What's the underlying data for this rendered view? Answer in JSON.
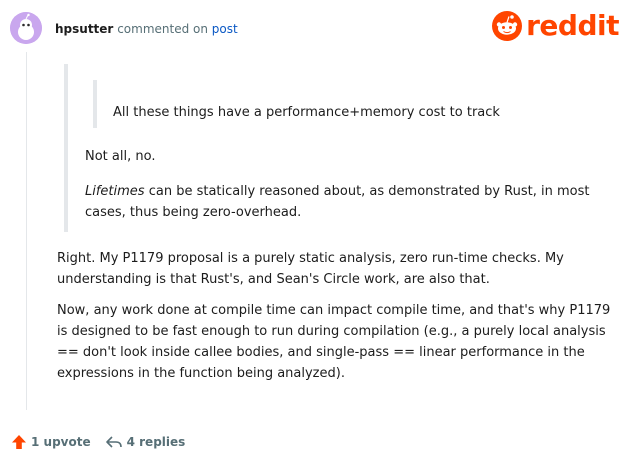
{
  "header": {
    "username": "hpsutter",
    "action_text": "commented on",
    "post_link": "post",
    "logo_text": "reddit"
  },
  "comment": {
    "nested_quote": "All these things have a performance+memory cost to track",
    "reply_line": "Not all, no.",
    "lifetimes_word": "Lifetimes",
    "lifetimes_rest": " can be statically reasoned about, as demonstrated by Rust, in most cases, thus being zero-overhead.",
    "paragraph_1": "Right. My P1179 proposal is a purely static analysis, zero run-time checks. My understanding is that Rust's, and Sean's Circle work, are also that.",
    "paragraph_2": "Now, any work done at compile time can impact compile time, and that's why P1179 is designed to be fast enough to run during compilation (e.g., a purely local analysis == don't look inside callee bodies, and single-pass == linear performance in the expressions in the function being analyzed)."
  },
  "footer": {
    "upvote_label": "1 upvote",
    "replies_label": "4 replies"
  },
  "colors": {
    "brand": "#ff4500",
    "link": "#0a58c4",
    "meta": "#576f76",
    "quote_bar": "#e4e7ea",
    "avatar_bg": "#c9a7ee"
  },
  "icons": [
    "snoo-avatar-icon",
    "reddit-logo-icon",
    "upvote-arrow-icon",
    "reply-arrow-icon"
  ]
}
